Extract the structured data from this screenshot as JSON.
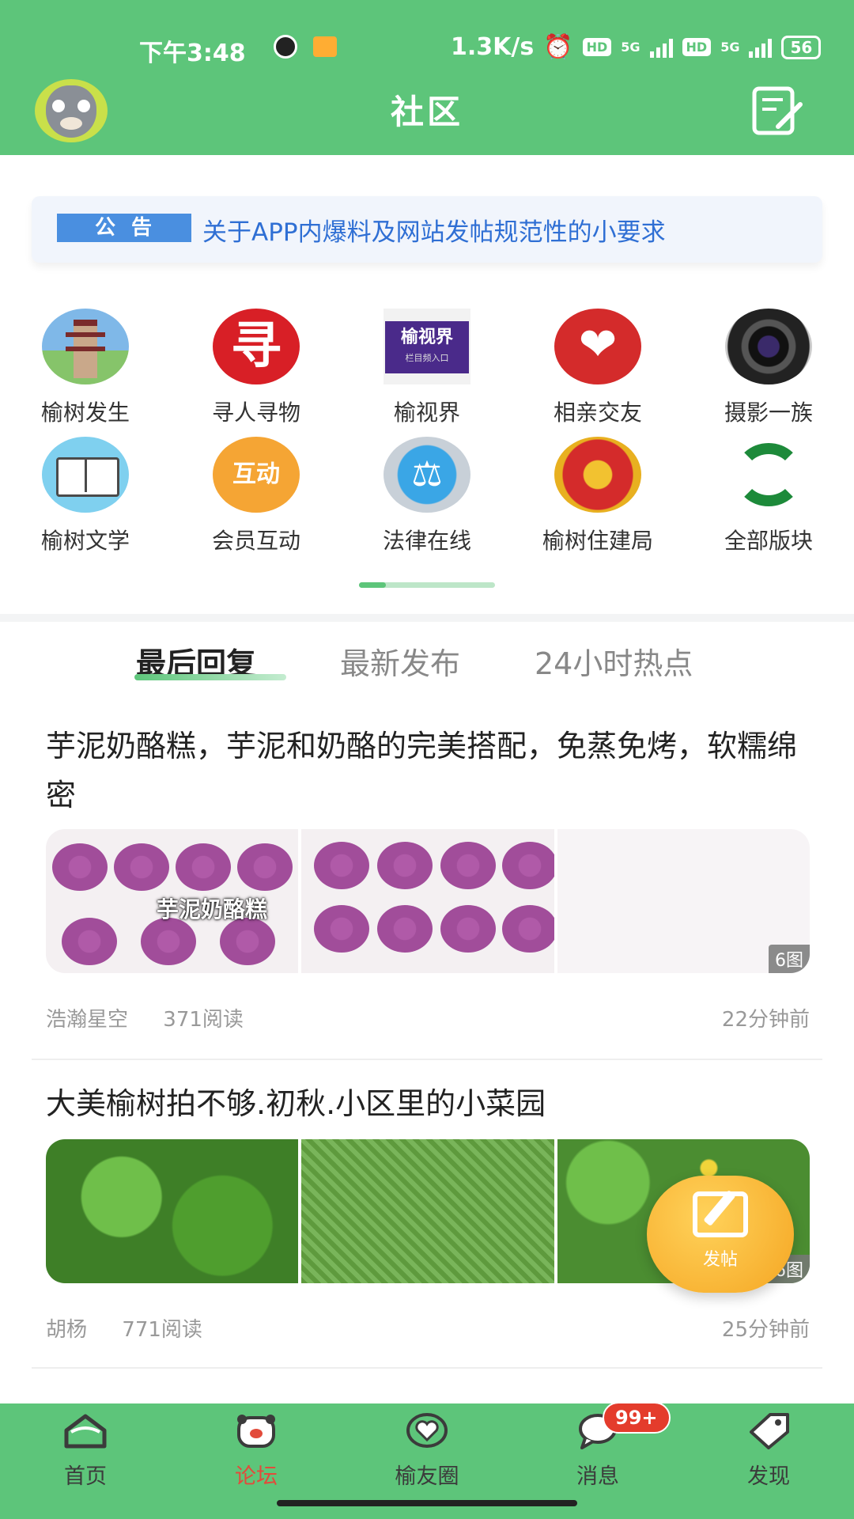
{
  "status_bar": {
    "time": "下午3:48",
    "network_speed": "1.3K/s",
    "hd1": "HD",
    "net1": "5G",
    "hd2": "HD",
    "net2": "5G",
    "battery": "56"
  },
  "header": {
    "title": "社区",
    "avatar_icon": "tom-cat-avatar",
    "compose_icon": "edit-note-icon"
  },
  "notice": {
    "tag": "公告",
    "text": "关于APP内爆料及网站发帖规范性的小要求"
  },
  "categories": [
    {
      "label": "榆树发生",
      "icon": "pagoda-icon"
    },
    {
      "label": "寻人寻物",
      "icon": "find-icon",
      "glyph": "寻"
    },
    {
      "label": "榆视界",
      "icon": "tv-logo-icon",
      "glyph": "榆视界",
      "sub": "栏目频入口"
    },
    {
      "label": "相亲交友",
      "icon": "heart-icon"
    },
    {
      "label": "摄影一族",
      "icon": "camera-lens-icon"
    },
    {
      "label": "榆树文学",
      "icon": "book-icon"
    },
    {
      "label": "会员互动",
      "icon": "interact-icon",
      "glyph": "互动"
    },
    {
      "label": "法律在线",
      "icon": "scales-icon"
    },
    {
      "label": "榆树住建局",
      "icon": "emblem-icon"
    },
    {
      "label": "全部版块",
      "icon": "all-sections-icon"
    }
  ],
  "tabs": [
    {
      "label": "最后回复",
      "active": true
    },
    {
      "label": "最新发布",
      "active": false
    },
    {
      "label": "24小时热点",
      "active": false
    }
  ],
  "posts": [
    {
      "title": "芋泥奶酪糕，芋泥和奶酪的完美搭配，免蒸免烤，软糯绵密",
      "image_caption": "芋泥奶酪糕",
      "image_count": "6图",
      "author": "浩瀚星空",
      "reads": "371阅读",
      "time": "22分钟前"
    },
    {
      "title": "大美榆树拍不够.初秋.小区里的小菜园",
      "image_count": "6图",
      "author": "胡杨",
      "reads": "771阅读",
      "time": "25分钟前"
    }
  ],
  "fab": {
    "label": "发帖"
  },
  "bottom_nav": [
    {
      "label": "首页",
      "icon": "home-icon",
      "active": false
    },
    {
      "label": "论坛",
      "icon": "forum-icon",
      "active": true
    },
    {
      "label": "榆友圈",
      "icon": "heart-circle-icon",
      "active": false
    },
    {
      "label": "消息",
      "icon": "message-icon",
      "active": false
    },
    {
      "label": "发现",
      "icon": "discover-icon",
      "active": false
    }
  ],
  "message_badge": "99+",
  "colors": {
    "primary": "#5dc57a",
    "accent": "#e24b3b",
    "notice_blue": "#2f6fd4"
  }
}
